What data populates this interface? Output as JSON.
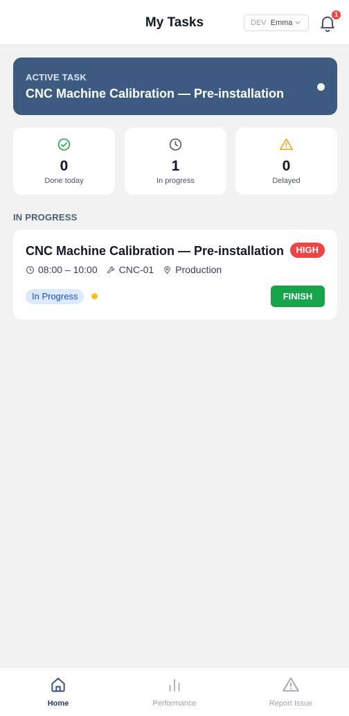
{
  "header": {
    "title": "My Tasks",
    "env": "DEV",
    "user": "Emma",
    "notification_count": "1"
  },
  "active_task": {
    "label": "ACTIVE TASK",
    "title": "CNC Machine Calibration — Pre-installation"
  },
  "stats": [
    {
      "value": "0",
      "label": "Done today",
      "icon": "check-circle-icon",
      "color": "#16a34a"
    },
    {
      "value": "1",
      "label": "In progress",
      "icon": "clock-icon",
      "color": "#475569"
    },
    {
      "value": "0",
      "label": "Delayed",
      "icon": "warning-icon",
      "color": "#f59e0b"
    }
  ],
  "section": {
    "in_progress_title": "IN PROGRESS"
  },
  "task": {
    "title": "CNC Machine Calibration — Pre-installation",
    "priority": "HIGH",
    "time": "08:00 – 10:00",
    "machine": "CNC-01",
    "location": "Production",
    "status": "In Progress",
    "action": "FINISH"
  },
  "nav": [
    {
      "label": "Home",
      "icon": "home-icon",
      "active": true
    },
    {
      "label": "Performance",
      "icon": "bar-chart-icon",
      "active": false
    },
    {
      "label": "Report Issue",
      "icon": "warning-icon",
      "active": false
    }
  ],
  "colors": {
    "accent": "#3d5a80",
    "high": "#ef4444",
    "finish": "#16a34a",
    "status_dot": "#fbbf24"
  }
}
